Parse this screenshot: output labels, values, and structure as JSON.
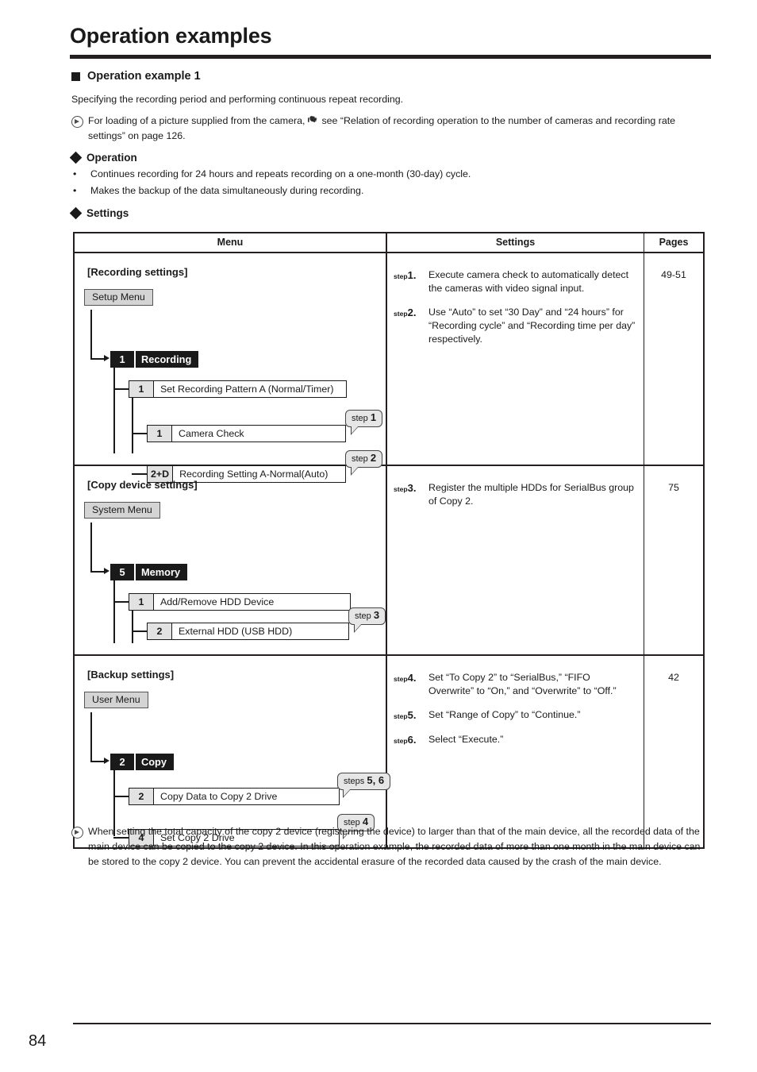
{
  "page": {
    "title": "Operation examples",
    "number": "84"
  },
  "section": {
    "heading": "Operation example 1",
    "intro": "Specifying the recording period and performing continuous repeat recording.",
    "note_top_part1": "For loading of a picture supplied from the camera,",
    "note_top_part2": "see “Relation of recording operation to the number of cameras and recording rate settings” on page 126.",
    "operation_heading": "Operation",
    "operation_bullets": [
      "Continues recording for 24 hours and repeats recording on a one-month (30-day) cycle.",
      "Makes the backup of the data simultaneously during recording."
    ],
    "settings_heading": "Settings",
    "note_bottom": "When setting the total capacity of the copy 2 device (registering the device) to larger than that of the main device, all the recorded data of the main device can be copied to the copy 2 device. In this operation example, the recorded data of more than one month in the main device can be stored to the copy 2 device. You can prevent the accidental erasure of the recorded data caused by the crash of the main device."
  },
  "table": {
    "headers": {
      "menu": "Menu",
      "settings": "Settings",
      "pages": "Pages"
    },
    "rows": [
      {
        "menu_title": "[Recording settings]",
        "root_button": "Setup Menu",
        "node_num": "1",
        "node_label": "Recording",
        "items": [
          {
            "num": "1",
            "text": "Set Recording Pattern A (Normal/Timer)",
            "callout": null
          },
          {
            "num": "1",
            "text": "Camera Check",
            "callout": {
              "word": "step",
              "value": "1"
            }
          },
          {
            "num": "2+D",
            "text": "Recording Setting A-Normal(Auto)",
            "callout": {
              "word": "step",
              "value": "2"
            }
          }
        ],
        "steps": [
          {
            "word": "step",
            "num": "1.",
            "text": "Execute camera check to automatically detect the cameras with video signal input."
          },
          {
            "word": "step",
            "num": "2.",
            "text": "Use “Auto” to set “30 Day” and “24 hours” for “Recording cycle” and “Recording time per day” respectively."
          }
        ],
        "pages": "49-51"
      },
      {
        "menu_title": "[Copy device settings]",
        "root_button": "System Menu",
        "node_num": "5",
        "node_label": "Memory",
        "items": [
          {
            "num": "1",
            "text": "Add/Remove HDD Device",
            "callout": null
          },
          {
            "num": "2",
            "text": "External HDD (USB HDD)",
            "callout": {
              "word": "step",
              "value": "3"
            }
          }
        ],
        "steps": [
          {
            "word": "step",
            "num": "3.",
            "text": "Register the multiple HDDs for SerialBus group of Copy 2."
          }
        ],
        "pages": "75"
      },
      {
        "menu_title": "[Backup settings]",
        "root_button": "User Menu",
        "node_num": "2",
        "node_label": "Copy",
        "items": [
          {
            "num": "2",
            "text": "Copy Data to Copy 2 Drive",
            "callout": {
              "word": "steps",
              "value": "5, 6"
            }
          },
          {
            "num": "4",
            "text": "Set Copy 2 Drive",
            "callout": {
              "word": "step",
              "value": "4"
            }
          }
        ],
        "steps": [
          {
            "word": "step",
            "num": "4.",
            "text": "Set “To Copy 2” to “SerialBus,” “FIFO Overwrite” to “On,” and “Overwrite” to “Off.”"
          },
          {
            "word": "step",
            "num": "5.",
            "text": "Set “Range of Copy” to “Continue.”"
          },
          {
            "word": "step",
            "num": "6.",
            "text": "Select “Execute.”"
          }
        ],
        "pages": "42"
      }
    ]
  },
  "icons": {
    "note_bullet": "circle-arrow-icon",
    "pointer": "pointing-hand-icon",
    "section_bullet": "filled-square-icon",
    "sub_bullet": "filled-diamond-icon"
  }
}
